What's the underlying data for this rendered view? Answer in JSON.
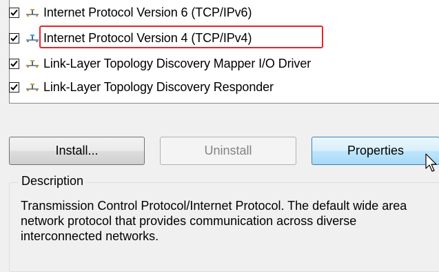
{
  "components": {
    "items": [
      {
        "label": "Internet Protocol Version 6 (TCP/IPv6)",
        "checked": true,
        "icon": "network-protocol-icon"
      },
      {
        "label": "Internet Protocol Version 4 (TCP/IPv4)",
        "checked": true,
        "icon": "network-protocol-icon",
        "highlighted": true
      },
      {
        "label": "Link-Layer Topology Discovery Mapper I/O Driver",
        "checked": true,
        "icon": "network-protocol-icon"
      },
      {
        "label": "Link-Layer Topology Discovery Responder",
        "checked": true,
        "icon": "network-protocol-icon"
      }
    ]
  },
  "buttons": {
    "install": "Install...",
    "uninstall": "Uninstall",
    "properties": "Properties"
  },
  "description": {
    "title": "Description",
    "text": "Transmission Control Protocol/Internet Protocol. The default wide area network protocol that provides communication across diverse interconnected networks."
  },
  "colors": {
    "highlight_border": "#e8232a",
    "properties_hover": "#bee6fd",
    "disabled_text": "#838383"
  }
}
